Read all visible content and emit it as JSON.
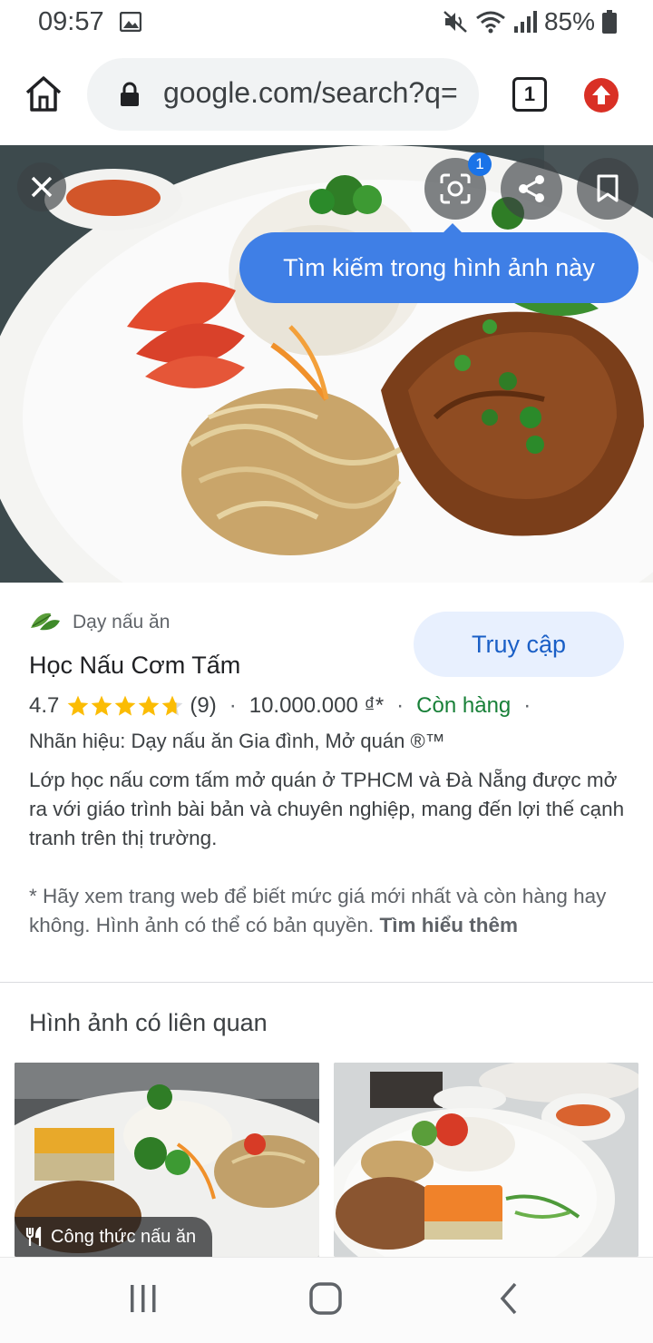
{
  "status_bar": {
    "time": "09:57",
    "battery": "85%",
    "icons": [
      "gallery-icon",
      "mute-icon",
      "wifi-icon",
      "signal-icon",
      "battery-icon"
    ]
  },
  "browser": {
    "url": "google.com/search?q=",
    "tab_count": "1",
    "icons": [
      "home-icon",
      "lock-icon",
      "tabs-icon",
      "update-icon"
    ]
  },
  "hero": {
    "lens_badge": "1",
    "tooltip": "Tìm kiếm trong hình ảnh này",
    "icons": [
      "close-icon",
      "lens-icon",
      "share-icon",
      "bookmark-icon"
    ]
  },
  "result": {
    "source": "Dạy nấu ăn",
    "visit_label": "Truy cập",
    "title": "Học Nấu Cơm Tấm",
    "rating": "4.7",
    "rating_stars": 4.7,
    "review_count": "(9)",
    "price": "10.000.000 ₫*",
    "stock": "Còn hàng",
    "brand": "Nhãn hiệu: Dạy nấu ăn Gia đình, Mở quán ®™",
    "description": "Lớp học nấu cơm tấm mở quán ở TPHCM và Đà Nẵng được mở ra với giáo trình bài bản và chuyên nghiệp, mang đến lợi thế cạnh tranh trên thị trường.",
    "disclaimer": "* Hãy xem trang web để biết mức giá mới nhất và còn hàng hay không. Hình ảnh có thể có bản quyền.",
    "learn_more": "Tìm hiểu thêm"
  },
  "related": {
    "heading": "Hình ảnh có liên quan",
    "items": [
      {
        "chip": "Công thức nấu ăn"
      },
      {
        "chip": ""
      }
    ]
  },
  "navbar": {
    "icons": [
      "recent-apps-icon",
      "home-nav-icon",
      "back-icon"
    ]
  },
  "colors": {
    "accent": "#1a73e8",
    "tooltip": "#3f7fe6",
    "visit_button_bg": "#e8f0fe",
    "stock_green": "#188038",
    "star": "#fbbc04"
  }
}
